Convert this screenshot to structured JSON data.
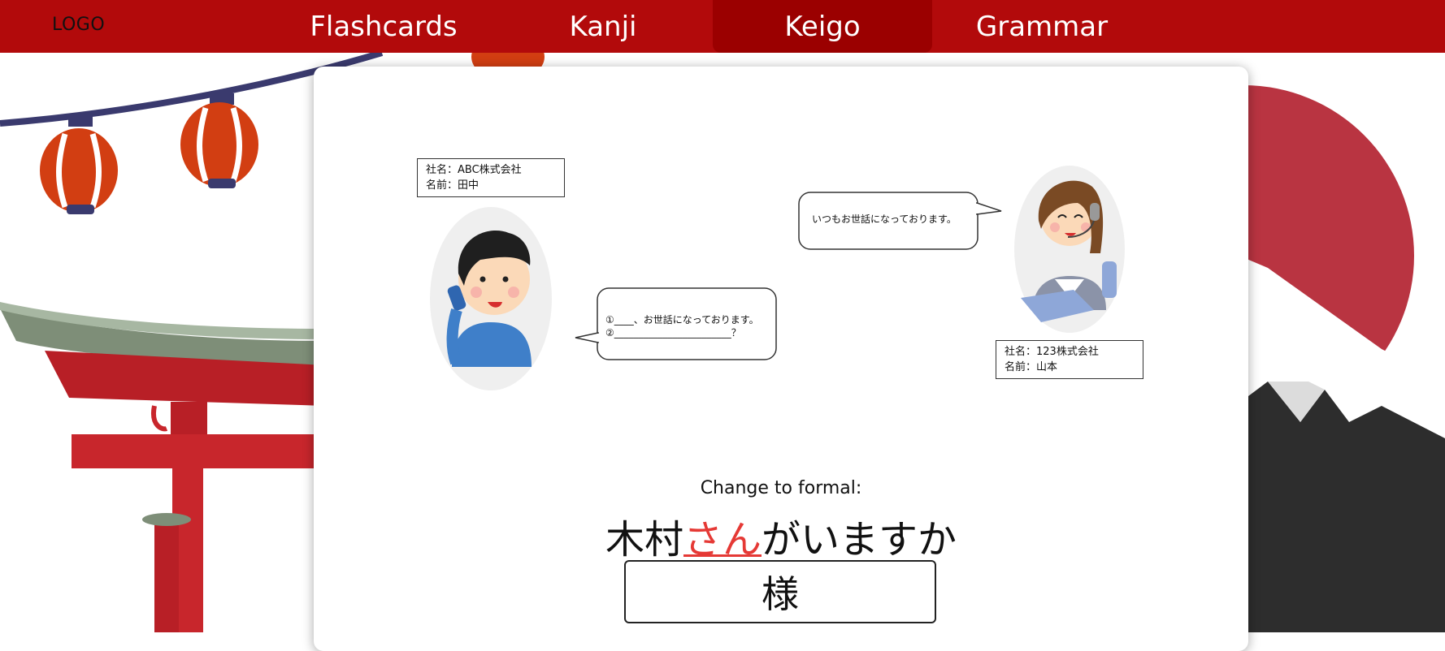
{
  "nav": {
    "logo": "LOGO",
    "items": [
      {
        "label": "Flashcards",
        "active": false
      },
      {
        "label": "Kanji",
        "active": false
      },
      {
        "label": "Keigo",
        "active": true
      },
      {
        "label": "Grammar",
        "active": false
      }
    ]
  },
  "colors": {
    "nav_bg": "#b20a0b",
    "nav_active": "#9b0000",
    "highlight": "#e53935"
  },
  "scene": {
    "caller_info": {
      "company": "社名：ABC株式会社",
      "name": "名前：田中"
    },
    "receiver_info": {
      "company": "社名：123株式会社",
      "name": "名前：山本"
    },
    "receiver_speech": "いつもお世話になっております。",
    "caller_speech": {
      "line1": "①____、お世話になっております。",
      "line2": "②________________________？"
    }
  },
  "quiz": {
    "prompt": "Change to formal:",
    "sentence_before": "木村",
    "sentence_highlight": "さん",
    "sentence_after": "がいますか",
    "answer": "様"
  }
}
